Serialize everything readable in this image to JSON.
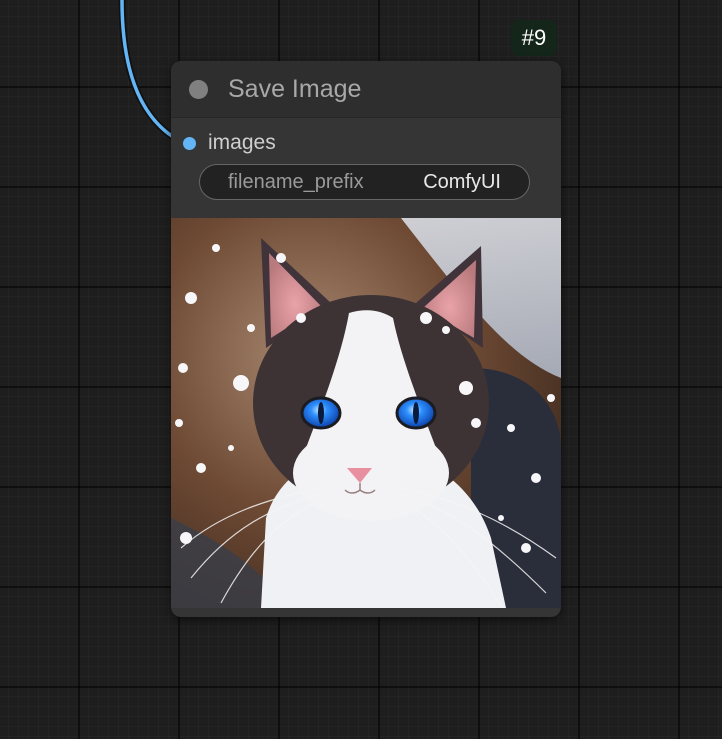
{
  "node": {
    "id_badge": "#9",
    "title": "Save Image",
    "input_slot": {
      "label": "images",
      "color": "#64b5f6"
    },
    "widget": {
      "name": "filename_prefix",
      "value": "ComfyUI"
    }
  },
  "preview": {
    "subject": "white-and-brown cat with blue eyes in snow"
  },
  "colors": {
    "canvas_bg": "#1e1e1e",
    "node_bg": "#353535",
    "title_bar": "#2e2e2e",
    "link_wire": "#64b5f6",
    "badge_bg": "#14261a"
  }
}
